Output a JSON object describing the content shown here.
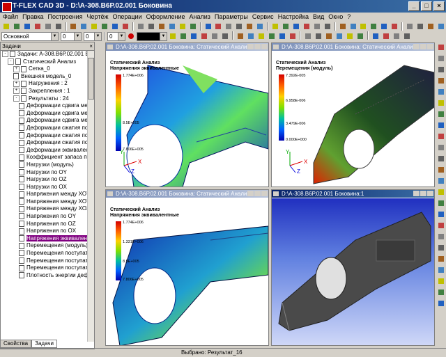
{
  "window": {
    "title": "T-FLEX CAD 3D - D:\\А-308.В6Р.02.001 Боковина"
  },
  "menu": [
    "Файл",
    "Правка",
    "Построения",
    "Чертёж",
    "Операции",
    "Оформление",
    "Анализ",
    "Параметры",
    "Сервис",
    "Настройка",
    "Вид",
    "Окно",
    "?"
  ],
  "toolbar": {
    "layer_value": "Основной",
    "width_value": "0",
    "num_value": "0",
    "num2_value": "0"
  },
  "panel": {
    "title": "Задачи",
    "close": "×"
  },
  "tree": [
    {
      "label": "Задачи: А-308.В6Р.02.001 Боковина",
      "level": 0,
      "exp": "-"
    },
    {
      "label": "Статический Анализ",
      "level": 1,
      "exp": "-"
    },
    {
      "label": "Сетка_0",
      "level": 2,
      "exp": "+"
    },
    {
      "label": "Внешняя модель_0",
      "level": 2
    },
    {
      "label": "Нагружения : 2",
      "level": 2,
      "exp": "+"
    },
    {
      "label": "Закрепления : 1",
      "level": 2,
      "exp": "+"
    },
    {
      "label": "Результаты : 24",
      "level": 2,
      "exp": "-"
    },
    {
      "label": "Деформации сдвига межд",
      "level": 3
    },
    {
      "label": "Деформации сдвига межд",
      "level": 3
    },
    {
      "label": "Деформации сдвига межд",
      "level": 3
    },
    {
      "label": "Деформации сжатия по OY",
      "level": 3
    },
    {
      "label": "Деформации сжатия по OZ",
      "level": 3
    },
    {
      "label": "Деформации сжатия по OX",
      "level": 3
    },
    {
      "label": "Деформации эквивалентные",
      "level": 3
    },
    {
      "label": "Коэффициент запаса по н",
      "level": 3
    },
    {
      "label": "Нагрузки (модуль)",
      "level": 3
    },
    {
      "label": "Нагрузки по OY",
      "level": 3
    },
    {
      "label": "Нагрузки по OZ",
      "level": 3
    },
    {
      "label": "Нагрузки по OX",
      "level": 3
    },
    {
      "label": "Напряжения между XOY и X",
      "level": 3
    },
    {
      "label": "Напряжения между XOY и Y",
      "level": 3
    },
    {
      "label": "Напряжения между XOZ и Y",
      "level": 3
    },
    {
      "label": "Напряжения по OY",
      "level": 3
    },
    {
      "label": "Напряжения по OZ",
      "level": 3
    },
    {
      "label": "Напряжения по OX",
      "level": 3
    },
    {
      "label": "Напряжения эквивалентные",
      "level": 3,
      "selected": true
    },
    {
      "label": "Перемещения (модуль)",
      "level": 3
    },
    {
      "label": "Перемещения поступател",
      "level": 3
    },
    {
      "label": "Перемещения поступател",
      "level": 3
    },
    {
      "label": "Перемещения поступател",
      "level": 3
    },
    {
      "label": "Плотность энергии дефор",
      "level": 3
    }
  ],
  "tabs": [
    "Свойства",
    "Задачи"
  ],
  "viewports": [
    {
      "title": "D:\\А-308.В6Р.02.001 Боковина: Статический Анализ",
      "label1": "Статический Анализ",
      "label2": "Напряжения эквивалентные",
      "legend": [
        "1.774E+006",
        "8.5E+005",
        "7.806E+005"
      ]
    },
    {
      "title": "D:\\А-308.В6Р.02.001 Боковина: Статический Анализ",
      "label1": "Статический Анализ",
      "label2": "Перемещения (модуль)",
      "legend": [
        "7.392E-005",
        "6.958E-006",
        "3.479E-006",
        "0.000E+000"
      ]
    },
    {
      "title": "D:\\А-308.В6Р.02.001 Боковина: Статический Анализ",
      "label1": "Статический Анализ",
      "label2": "Напряжения эквивалентные",
      "legend": [
        "1.774E+006",
        "1.331E+006",
        "8.5E+005",
        "7.806E+005"
      ]
    },
    {
      "title": "D:\\А-308.В6Р.02.001 Боковина:1"
    }
  ],
  "axes": {
    "x": "X",
    "y": "Y",
    "z": "Z"
  },
  "status": {
    "text": "Выбрано: Результат_16"
  }
}
